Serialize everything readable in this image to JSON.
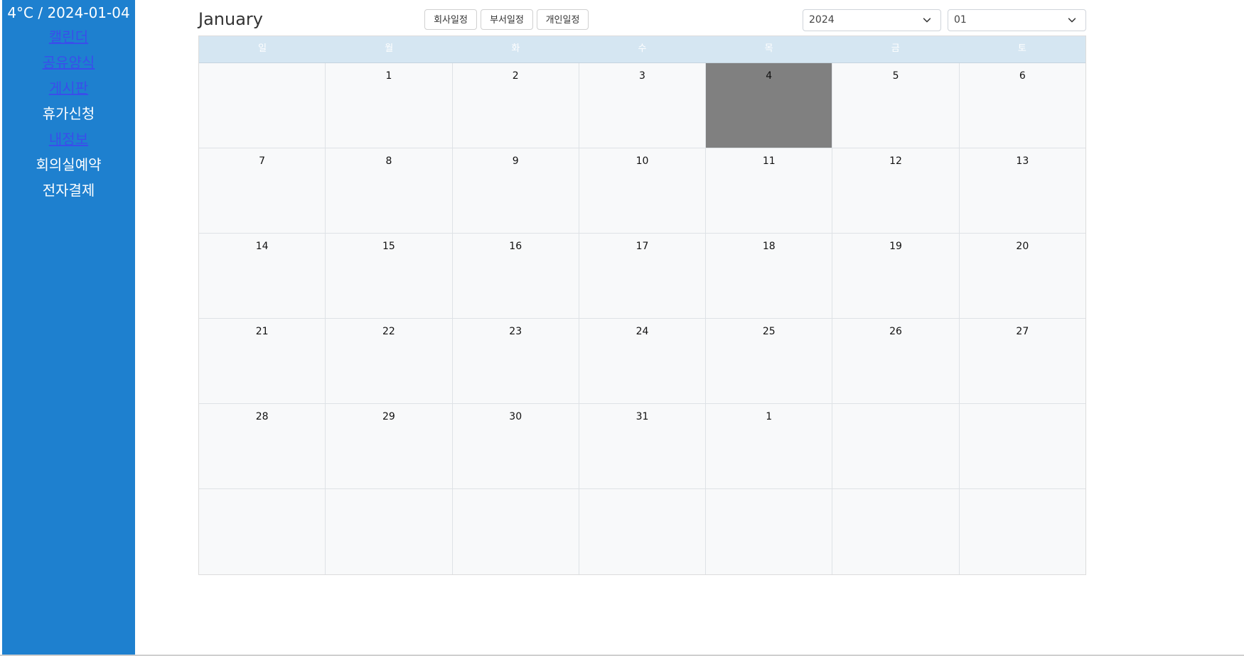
{
  "sidebar": {
    "weather": "4°C / 2024-01-04",
    "items": [
      {
        "label": "캘린더",
        "style": "link"
      },
      {
        "label": "공유양식",
        "style": "link"
      },
      {
        "label": "게시판",
        "style": "link"
      },
      {
        "label": "휴가신청",
        "style": "plain"
      },
      {
        "label": "내정보",
        "style": "link"
      },
      {
        "label": "회의실예약",
        "style": "plain"
      },
      {
        "label": "전자결제",
        "style": "plain"
      }
    ]
  },
  "header": {
    "month_title": "January",
    "filters": [
      "회사일정",
      "부서일정",
      "개인일정"
    ],
    "year_select": {
      "value": "2024"
    },
    "month_select": {
      "value": "01"
    }
  },
  "calendar": {
    "weekdays": [
      "일",
      "월",
      "화",
      "수",
      "목",
      "금",
      "토"
    ],
    "weeks": [
      [
        "",
        "1",
        "2",
        "3",
        "4",
        "5",
        "6"
      ],
      [
        "7",
        "8",
        "9",
        "10",
        "11",
        "12",
        "13"
      ],
      [
        "14",
        "15",
        "16",
        "17",
        "18",
        "19",
        "20"
      ],
      [
        "21",
        "22",
        "23",
        "24",
        "25",
        "26",
        "27"
      ],
      [
        "28",
        "29",
        "30",
        "31",
        "1",
        "",
        ""
      ],
      [
        "",
        "",
        "",
        "",
        "",
        "",
        ""
      ]
    ],
    "today": {
      "week": 0,
      "day": 4
    }
  },
  "colors": {
    "sidebar_bg": "#1e80cf",
    "link": "#3a4eea",
    "header_bg": "#d5e6f2",
    "today_bg": "#808080"
  },
  "icons": {
    "select_arrow": "chevron-down-icon"
  }
}
